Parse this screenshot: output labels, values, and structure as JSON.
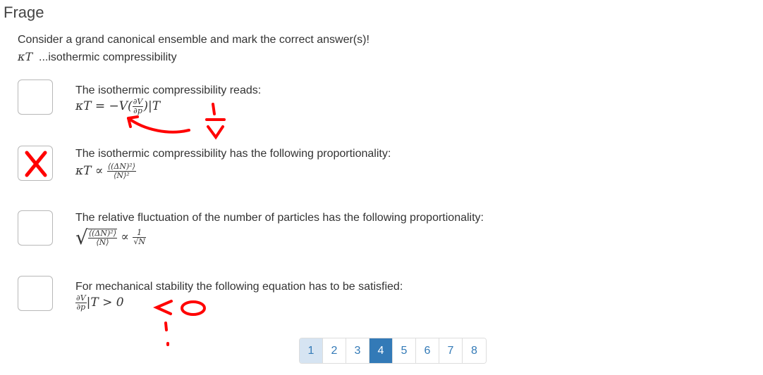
{
  "header": {
    "title": "Frage"
  },
  "intro": {
    "prompt": "Consider a grand canonical ensemble and mark the correct answer(s)!",
    "kappa_symbol": "κT",
    "definition": "...isothermic compressibility"
  },
  "questions": [
    {
      "text": "The isothermic compressibility reads:",
      "checked": false,
      "formula": {
        "lhs": "κT = −V(",
        "num": "∂V",
        "den": "∂p",
        "rhs": ")|T"
      }
    },
    {
      "text": "The isothermic compressibility has the following proportionality:",
      "checked": true,
      "formula": {
        "lhs": "κT ∝",
        "num": "⟨(ΔN)²⟩",
        "den": "⟨N⟩²"
      }
    },
    {
      "text": "The relative fluctuation of the number of particles has the following proportionality:",
      "checked": false,
      "formula": {
        "num": "⟨(ΔN)²⟩",
        "den": "⟨N⟩",
        "prop": "∝",
        "num2": "1",
        "den2": "√N"
      }
    },
    {
      "text": "For mechanical stability the following equation has to be satisfied:",
      "checked": false,
      "formula": {
        "num": "∂V",
        "den": "∂p",
        "rhs": "|T > 0"
      }
    }
  ],
  "annotations": {
    "q1_mark": "red-arrow-and-sign-flip",
    "q4_mark": "<0",
    "color": "#ff0000"
  },
  "pagination": {
    "pages": [
      "1",
      "2",
      "3",
      "4",
      "5",
      "6",
      "7",
      "8"
    ],
    "current": "4",
    "visited": "1",
    "accent": "#337ab7"
  }
}
